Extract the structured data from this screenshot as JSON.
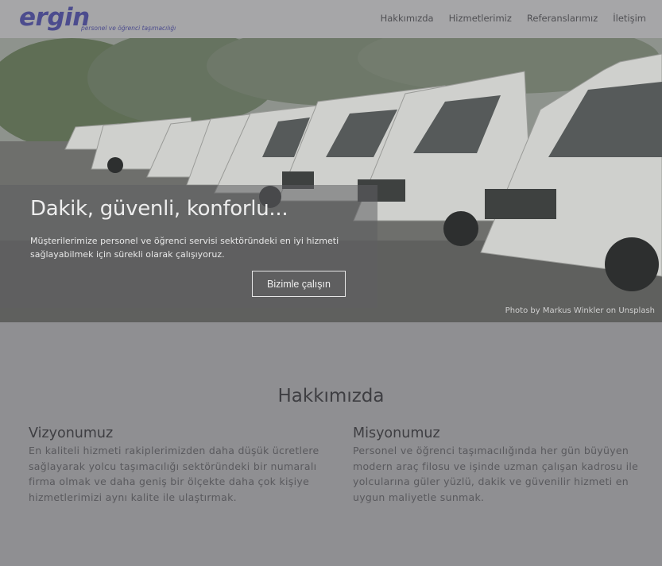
{
  "brand": {
    "name": "ergin",
    "tagline": "personel ve öğrenci taşımacılığı"
  },
  "nav": {
    "items": [
      "Hakkımızda",
      "Hizmetlerimiz",
      "Referanslarımız",
      "İletişim"
    ]
  },
  "hero": {
    "title": "Dakik, güvenli, konforlu...",
    "description": "Müşterilerimize personel ve öğrenci servisi sektöründeki en iyi hizmeti sağlayabilmek için sürekli olarak çalışıyoruz.",
    "button_label": "Bizimle çalışın",
    "photo_credit": "Photo by Markus Winkler on Unsplash"
  },
  "about": {
    "title": "Hakkımızda",
    "vision_title": "Vizyonumuz",
    "vision_text": "En kaliteli hizmeti rakiplerimizden daha düşük ücretlere sağlayarak yolcu taşımacılığı sektöründeki bir numaralı firma olmak ve daha geniş bir ölçekte daha çok kişiye hizmetlerimizi aynı kalite ile ulaştırmak.",
    "mission_title": "Misyonumuz",
    "mission_text": "Personel ve öğrenci taşımacılığında her gün büyüyen modern araç filosu ve işinde uzman çalışan kadrosu ile yolcularına güler yüzlü, dakik ve güvenilir hizmeti en uygun maliyetle sunmak."
  }
}
